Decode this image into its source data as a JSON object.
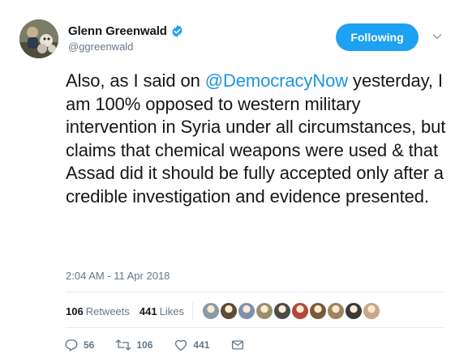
{
  "user": {
    "display_name": "Glenn Greenwald",
    "handle": "@ggreenwald",
    "verified_icon": "verified-badge-icon",
    "avatar_icon": "profile-avatar"
  },
  "follow_button": {
    "label": "Following"
  },
  "menu_icon": "chevron-down-icon",
  "tweet": {
    "text_before": "Also, as I said on ",
    "mention": "@DemocracyNow",
    "text_after": " yesterday, I am 100% opposed to western military intervention in Syria under all circumstances, but claims that chemical weapons were used & that Assad did it should be fully accepted only after a credible investigation and evidence presented."
  },
  "timestamp": "2:04 AM - 11 Apr 2018",
  "stats": {
    "retweets_count": "106",
    "retweets_label": "Retweets",
    "likes_count": "441",
    "likes_label": "Likes"
  },
  "likers": [
    {
      "color": "#8a9aa6"
    },
    {
      "color": "#5b4b3a"
    },
    {
      "color": "#7e8fb0"
    },
    {
      "color": "#9a8f6e"
    },
    {
      "color": "#4a4a4a"
    },
    {
      "color": "#b04a3c"
    },
    {
      "color": "#7a5a3a"
    },
    {
      "color": "#a08060"
    },
    {
      "color": "#3a3a3a"
    },
    {
      "color": "#c9a58a"
    }
  ],
  "actions": {
    "reply_count": "56",
    "retweet_count": "106",
    "like_count": "441"
  },
  "colors": {
    "accent": "#1da1f2",
    "link": "#1b95e0",
    "muted": "#657786",
    "text": "#14171a",
    "divider": "#e6ecf0"
  }
}
